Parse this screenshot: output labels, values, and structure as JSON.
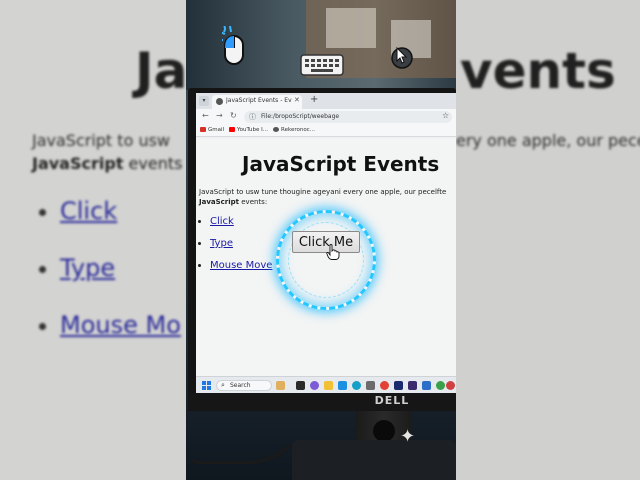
{
  "background": {
    "heading": "JavaScript Events",
    "heading_left_fragment": "Ja",
    "heading_right_fragment": "vents",
    "para_left": "JavaScript to usw",
    "para_right": "ery one apple, our pecelfte",
    "para_bold": "JavaScript",
    "para_rest": " events",
    "items": [
      "Click",
      "Type",
      "Mouse Mo"
    ]
  },
  "monitor": {
    "brand": "DELL"
  },
  "browser": {
    "tab_title": "JavaScript Events - Events",
    "new_tab": "+",
    "url": "File:/bropoScript/weebage",
    "bookmarks": [
      "Gmail",
      "YouTube I...",
      "Rekeronoc..."
    ],
    "back": "←",
    "forward": "→",
    "reload": "↻",
    "star": "☆"
  },
  "page": {
    "title": "JavaScript Events",
    "para_line1": "JavaScript to usw tune thougine ageyani every one apple, our pecelfte",
    "para_bold": "JavaScript",
    "para_line2_rest": " events:",
    "events": [
      "Click",
      "Type",
      "Mouse Move"
    ],
    "button_label": "Click Me"
  },
  "taskbar": {
    "search_label": "Search",
    "search_icon": "⌕"
  },
  "colors": {
    "glow": "#25c7ff",
    "link": "#1a1aa6",
    "monitor": "#141414"
  },
  "icons": [
    "mouse-icon",
    "keyboard-icon",
    "cursor-icon",
    "hand-cursor-icon",
    "sparkle-icon",
    "windows-start-icon"
  ]
}
